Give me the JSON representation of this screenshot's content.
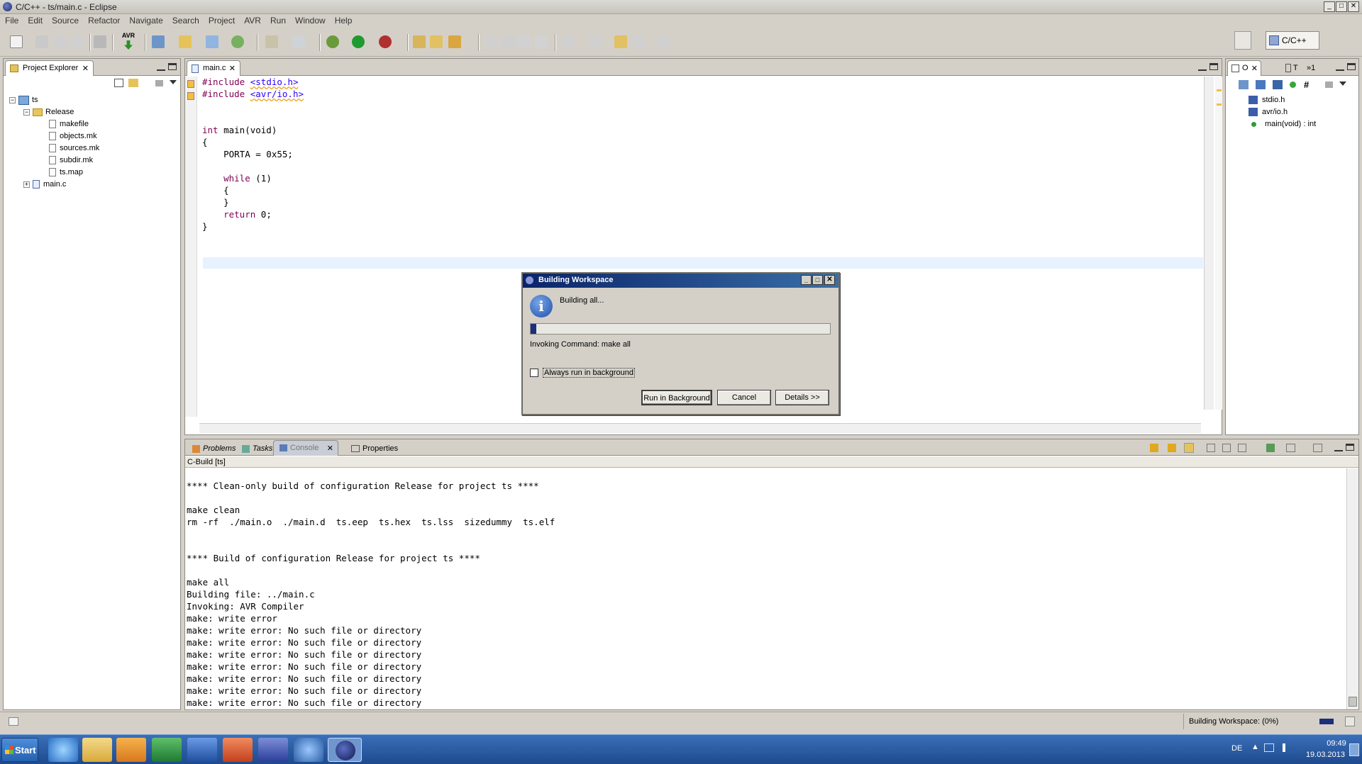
{
  "window": {
    "title": "C/C++ - ts/main.c - Eclipse",
    "controls": [
      "_",
      "□",
      "✕"
    ]
  },
  "menu": [
    "File",
    "Edit",
    "Source",
    "Refactor",
    "Navigate",
    "Search",
    "Project",
    "AVR",
    "Run",
    "Window",
    "Help"
  ],
  "toolbar": {
    "avr_label": "AVR",
    "perspective": "C/C++"
  },
  "project_explorer": {
    "tab": "Project Explorer",
    "tree": {
      "project": "ts",
      "folder": "Release",
      "files": [
        "makefile",
        "objects.mk",
        "sources.mk",
        "subdir.mk",
        "ts.map"
      ],
      "source": "main.c"
    }
  },
  "editor": {
    "tab": "main.c",
    "lines": [
      "#include <stdio.h>",
      "#include <avr/io.h>",
      "",
      "",
      "int main(void)",
      "{",
      "    PORTA = 0x55;",
      "",
      "    while (1)",
      "    {",
      "    }",
      "    return 0;",
      "}"
    ]
  },
  "outline": {
    "tabs": [
      "O",
      "T",
      "1"
    ],
    "items": [
      "stdio.h",
      "avr/io.h",
      "main(void) : int"
    ]
  },
  "bottom_tabs": [
    "Problems",
    "Tasks",
    "Console",
    "Properties"
  ],
  "console": {
    "header": "C-Build [ts]",
    "lines": [
      "",
      "**** Clean-only build of configuration Release for project ts ****",
      "",
      "make clean",
      "rm -rf  ./main.o  ./main.d  ts.eep  ts.hex  ts.lss  sizedummy  ts.elf",
      "",
      "",
      "**** Build of configuration Release for project ts ****",
      "",
      "make all",
      "Building file: ../main.c",
      "Invoking: AVR Compiler",
      "make: write error",
      "make: write error: No such file or directory",
      "make: write error: No such file or directory",
      "make: write error: No such file or directory",
      "make: write error: No such file or directory",
      "make: write error: No such file or directory",
      "make: write error: No such file or directory",
      "make: write error: No such file or directory"
    ]
  },
  "dialog": {
    "title": "Building Workspace",
    "message": "Building all...",
    "progress": 0.02,
    "task": "Invoking Command: make all",
    "checkbox": "Always run in background",
    "buttons": {
      "run_bg": "Run in Background",
      "cancel": "Cancel",
      "details": "Details >>"
    }
  },
  "status": {
    "progress_text": "Building Workspace: (0%)"
  },
  "taskbar": {
    "start": "Start",
    "lang": "DE",
    "time": "09:49",
    "date": "19.03.2013"
  },
  "colors": {
    "keyword": "#7f0055",
    "include": "#2a00ff",
    "dialog_title": "#0a246a",
    "taskbar": "#1e4a8d"
  }
}
